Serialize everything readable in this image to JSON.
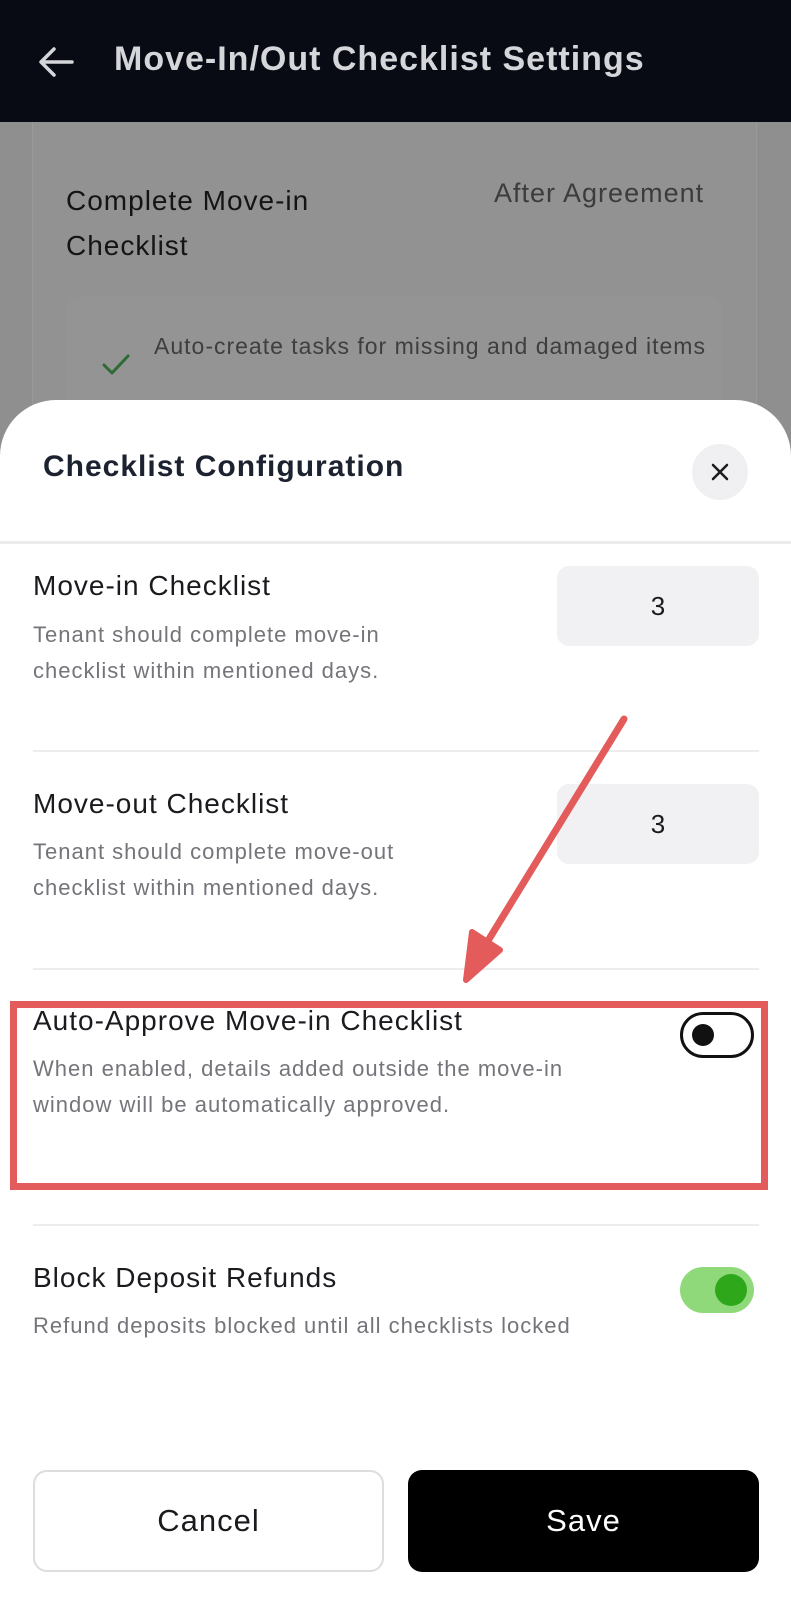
{
  "header": {
    "title": "Move-In/Out Checklist Settings"
  },
  "background_card": {
    "title": "Complete Move-in Checklist",
    "tag": "After Agreement",
    "task": "Auto-create tasks for missing and damaged items"
  },
  "sheet": {
    "title": "Checklist Configuration",
    "move_in": {
      "title": "Move-in Checklist",
      "desc": "Tenant should complete move-in checklist within mentioned days.",
      "days": "3"
    },
    "move_out": {
      "title": "Move-out Checklist",
      "desc": "Tenant should complete move-out checklist within mentioned days.",
      "days": "3"
    },
    "auto_approve": {
      "title": "Auto-Approve Move-in Checklist",
      "desc": "When enabled, details added outside the move-in window will be automatically approved.",
      "enabled": false
    },
    "block_refunds": {
      "title": "Block Deposit Refunds",
      "desc": "Refund deposits blocked until all checklists locked",
      "enabled": true
    },
    "cancel_label": "Cancel",
    "save_label": "Save"
  },
  "colors": {
    "appbar": "#080b14",
    "highlight": "#e45b5b",
    "toggle_on": "#8fd97a",
    "toggle_knob_on": "#2ea81a",
    "check": "#2f7d32"
  }
}
